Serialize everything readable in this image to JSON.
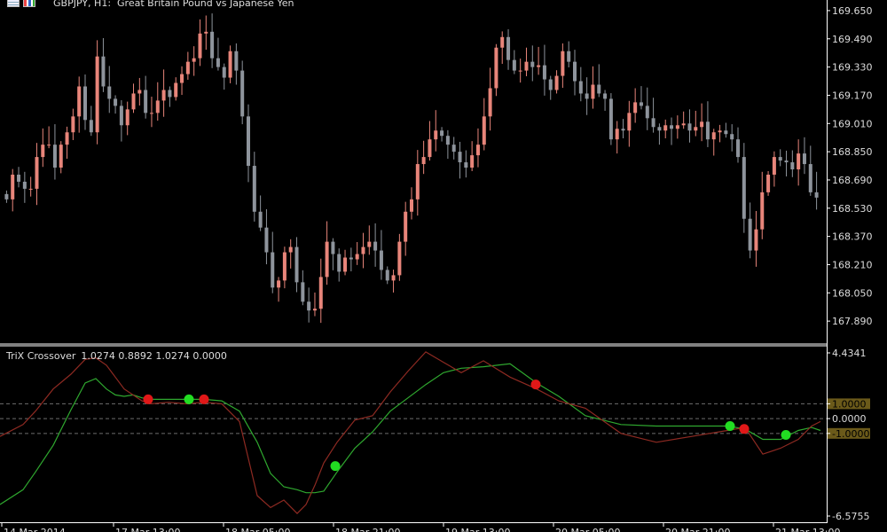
{
  "header": {
    "symbol": "GBPJPY, H1:",
    "description": "Great Britain Pound vs Japanese Yen"
  },
  "indicator": {
    "title": "TriX Crossover",
    "values": "1.0274 0.8892 1.0274 0.0000"
  },
  "colors": {
    "bull": "#e8857a",
    "bear": "#8e949c",
    "fast": "#2fa82f",
    "slow": "#8e2a22",
    "buy_dot": "#22dd22",
    "sell_dot": "#e01818",
    "level_box": "#6b5a1a"
  },
  "chart_data": [
    {
      "type": "candlestick",
      "title": "GBPJPY, H1:  Great Britain Pound vs Japanese Yen",
      "ylim": [
        167.76,
        169.71
      ],
      "y_ticks": [
        "169.650",
        "169.490",
        "169.330",
        "169.170",
        "169.010",
        "168.850",
        "168.690",
        "168.530",
        "168.370",
        "168.210",
        "168.050",
        "167.890"
      ],
      "x_ticks": [
        "14 Mar 2014",
        "17 Mar 13:00",
        "18 Mar 05:00",
        "18 Mar 21:00",
        "19 Mar 13:00",
        "20 Mar 05:00",
        "20 Mar 21:00",
        "21 Mar 13:00"
      ],
      "close": [
        168.58,
        168.72,
        168.68,
        168.64,
        168.64,
        168.82,
        168.89,
        168.89,
        168.76,
        168.89,
        168.96,
        169.05,
        169.22,
        169.03,
        168.96,
        169.39,
        169.22,
        169.15,
        169.11,
        169.0,
        169.09,
        169.18,
        169.2,
        169.07,
        169.07,
        169.14,
        169.2,
        169.16,
        169.24,
        169.29,
        169.36,
        169.38,
        169.52,
        169.53,
        169.38,
        169.33,
        169.27,
        169.42,
        169.31,
        169.05,
        168.77,
        168.51,
        168.42,
        168.28,
        168.08,
        168.12,
        168.28,
        168.31,
        168.11,
        168.0,
        167.95,
        167.96,
        168.14,
        168.34,
        168.27,
        168.17,
        168.25,
        168.24,
        168.27,
        168.31,
        168.34,
        168.29,
        168.18,
        168.12,
        168.15,
        168.34,
        168.51,
        168.58,
        168.78,
        168.82,
        168.92,
        168.97,
        168.94,
        168.89,
        168.85,
        168.79,
        168.76,
        168.83,
        168.89,
        169.05,
        169.21,
        169.44,
        169.5,
        169.37,
        169.31,
        169.31,
        169.36,
        169.33,
        169.34,
        169.26,
        169.2,
        169.28,
        169.42,
        169.36,
        169.25,
        169.18,
        169.15,
        169.23,
        169.18,
        169.15,
        168.92,
        168.98,
        168.97,
        169.07,
        169.13,
        169.11,
        169.04,
        168.99,
        168.97,
        169.0,
        168.98,
        169.0,
        169.01,
        168.97,
        168.99,
        169.02,
        168.92,
        168.96,
        168.97,
        168.95,
        168.92,
        168.82,
        168.47,
        168.29,
        168.41,
        168.62,
        168.72,
        168.82,
        168.8,
        168.79,
        168.75,
        168.84,
        168.78,
        168.62,
        168.59
      ],
      "notes": "Series values: 136 hourly candles read approximately from the chart (closes in price units); opens are the previous close."
    },
    {
      "type": "line",
      "title": "TriX Crossover",
      "ylim": [
        -6.5755,
        4.4341
      ],
      "y_ticks": [
        "4.4341",
        "1.0000",
        "0.0000",
        "-1.0000",
        "-6.5755"
      ],
      "levels": [
        1.0,
        0.0,
        -1.0
      ],
      "series": [
        {
          "x": [
            0,
            26,
            40,
            60,
            80,
            96,
            108,
            120,
            130,
            140,
            150,
            160,
            170,
            190,
            210,
            230,
            250,
            270,
            290,
            305,
            320,
            335,
            345,
            355,
            365,
            380,
            400,
            420,
            440,
            460,
            480,
            500,
            520,
            545,
            575,
            605,
            630,
            660,
            700,
            740,
            780,
            820,
            840,
            860,
            880,
            900,
            915,
            925
          ],
          "values": [
            -5.8,
            -4.8,
            -3.6,
            -1.8,
            0.6,
            2.4,
            2.7,
            2.0,
            1.6,
            1.5,
            1.6,
            1.4,
            1.3,
            1.3,
            1.3,
            1.3,
            1.2,
            0.5,
            -1.6,
            -3.7,
            -4.6,
            -4.8,
            -5.0,
            -5.0,
            -4.9,
            -3.6,
            -2.0,
            -0.9,
            0.5,
            1.4,
            2.3,
            3.1,
            3.4,
            3.5,
            3.7,
            2.4,
            1.5,
            0.2,
            -0.4,
            -0.5,
            -0.5,
            -0.5,
            -0.7,
            -1.4,
            -1.4,
            -0.8,
            -0.6,
            -0.8
          ]
        },
        {
          "x": [
            0,
            26,
            40,
            60,
            80,
            96,
            108,
            120,
            130,
            140,
            150,
            160,
            170,
            190,
            210,
            230,
            250,
            270,
            290,
            305,
            320,
            335,
            345,
            355,
            365,
            380,
            400,
            420,
            440,
            460,
            480,
            500,
            520,
            545,
            575,
            605,
            630,
            660,
            700,
            740,
            780,
            820,
            840,
            860,
            880,
            900,
            915,
            925
          ],
          "values": [
            -1.2,
            -0.4,
            0.5,
            2.0,
            3.0,
            4.0,
            4.1,
            3.6,
            2.8,
            2.0,
            1.6,
            1.2,
            1.0,
            1.1,
            1.0,
            1.1,
            1.0,
            -0.2,
            -5.2,
            -6.0,
            -5.5,
            -6.4,
            -5.8,
            -4.5,
            -3.0,
            -1.6,
            -0.1,
            0.2,
            1.8,
            3.2,
            4.5,
            3.8,
            3.1,
            3.9,
            2.8,
            2.0,
            1.2,
            0.7,
            -1.0,
            -1.6,
            -1.2,
            -0.8,
            -0.6,
            -2.4,
            -2.0,
            -1.4,
            -0.5,
            -0.2
          ]
        }
      ],
      "signals": [
        {
          "type": "sell",
          "x": 167,
          "y": 1.3
        },
        {
          "type": "buy",
          "x": 213,
          "y": 1.3
        },
        {
          "type": "sell",
          "x": 230,
          "y": 1.3
        },
        {
          "type": "buy",
          "x": 378,
          "y": -3.2
        },
        {
          "type": "sell",
          "x": 604,
          "y": 2.3
        },
        {
          "type": "buy",
          "x": 823,
          "y": -0.5
        },
        {
          "type": "sell",
          "x": 839,
          "y": -0.7
        },
        {
          "type": "buy",
          "x": 886,
          "y": -1.1
        }
      ]
    }
  ]
}
